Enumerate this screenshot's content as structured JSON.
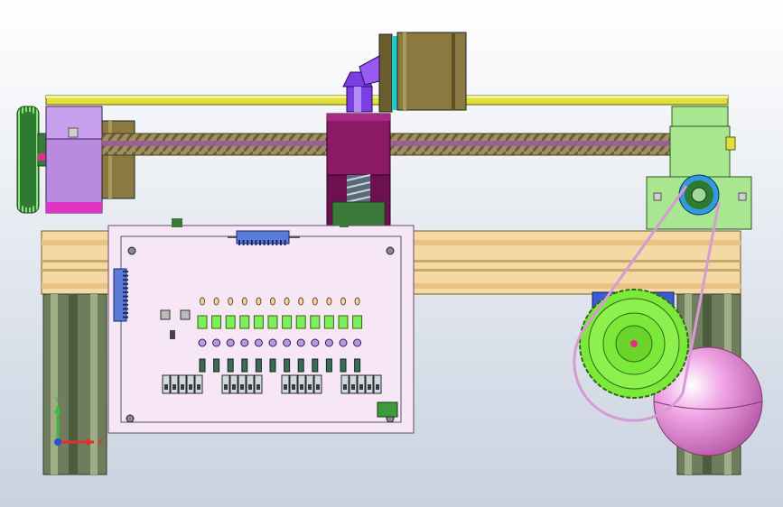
{
  "scene": {
    "background_top": "#ffffff",
    "background_bottom": "#c9d2e0",
    "colors": {
      "frame_rail": "#f4d9a4",
      "frame_rail_dark": "#c9a86a",
      "aluminum_leg": "#6f7d5c",
      "aluminum_leg_light": "#9fae86",
      "top_rod": "#e0de3c",
      "lead_screw": "#a18f64",
      "carriage_magenta": "#8a1a66",
      "motor_body": "#8a7a3f",
      "bearing_block_purple": "#b98ae0",
      "bearing_block_green": "#a8e690",
      "pulley_green": "#7be83a",
      "gear_dark_green": "#2e7a32",
      "belt": "#d69ad6",
      "sphere_pink": "#f1a7e6",
      "pcb": "#f6e6f6",
      "pcb_led": "#7cf05a",
      "connector_blue": "#5a7bd8",
      "bevel_gear": "#7a3fe0",
      "cyan_ring": "#1ec9c9"
    }
  },
  "axes": {
    "x_label": "X",
    "y_label": "Y",
    "x_color": "#e23030",
    "y_color": "#3dbb3d",
    "origin_color": "#2850d8"
  }
}
